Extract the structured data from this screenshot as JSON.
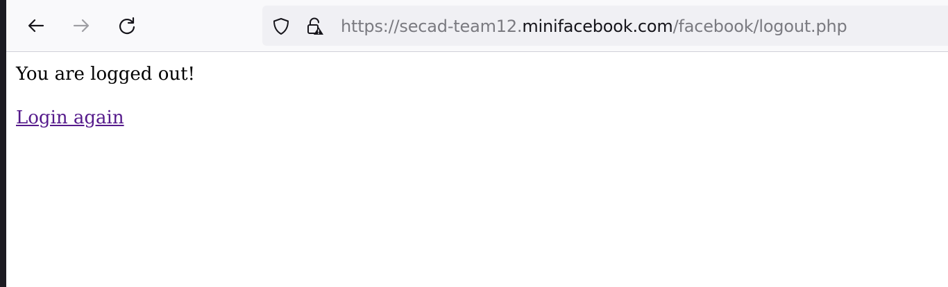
{
  "toolbar": {
    "back_icon": "arrow-left-icon",
    "forward_icon": "arrow-right-icon",
    "reload_icon": "reload-icon"
  },
  "urlbar": {
    "shield_icon": "tracking-protection-shield-icon",
    "lock_icon": "insecure-lock-warning-icon",
    "url_prefix": "https://secad-team12.",
    "url_host": "minifacebook.com",
    "url_path": "/facebook/logout.php"
  },
  "page": {
    "message": "You are logged out!",
    "login_link": "Login again",
    "link_color": "#551a8b"
  }
}
